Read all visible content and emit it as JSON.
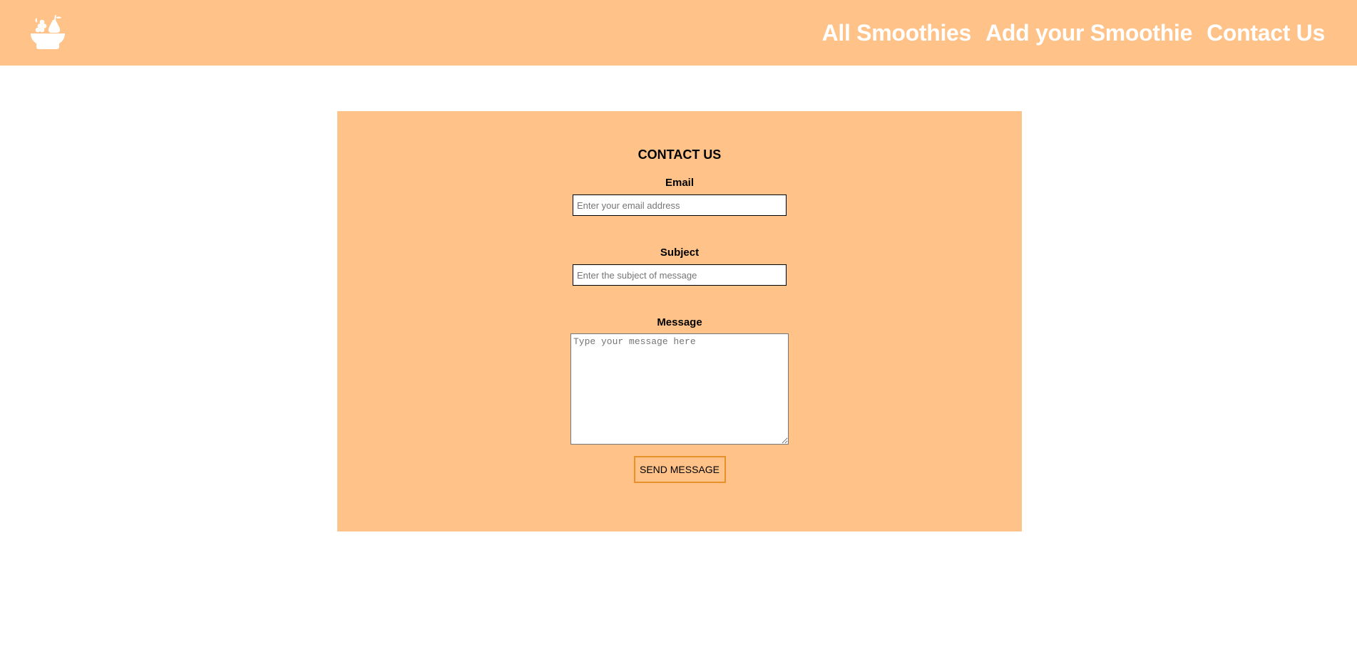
{
  "header": {
    "logo_icon": "fruit-bowl-icon",
    "nav": [
      {
        "label": "All Smoothies"
      },
      {
        "label": "Add your Smoothie"
      },
      {
        "label": "Contact Us"
      }
    ]
  },
  "form": {
    "title": "CONTACT US",
    "email": {
      "label": "Email",
      "placeholder": "Enter your email address",
      "value": ""
    },
    "subject": {
      "label": "Subject",
      "placeholder": "Enter the subject of message",
      "value": ""
    },
    "message": {
      "label": "Message",
      "placeholder": "Type your message here",
      "value": ""
    },
    "submit_label": "SEND MESSAGE"
  },
  "colors": {
    "header_bg": "#ffc288",
    "panel_bg": "#ffc288",
    "nav_text": "#ffffff",
    "button_border": "#e8902a"
  }
}
